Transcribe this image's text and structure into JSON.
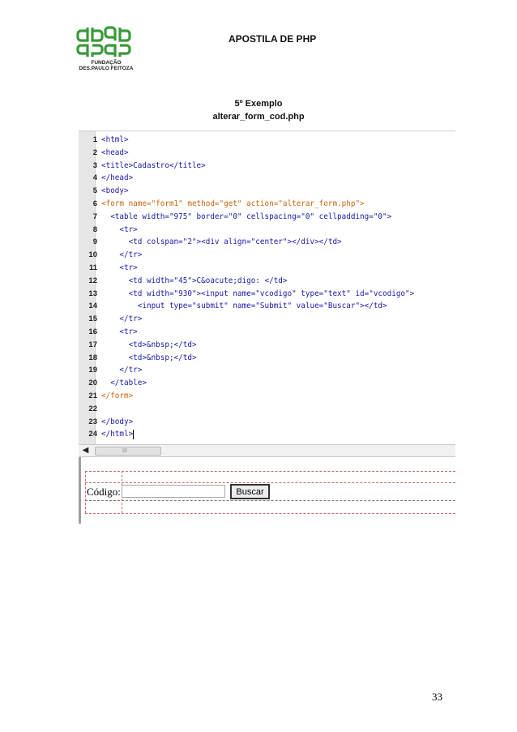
{
  "header": {
    "title": "APOSTILA DE PHP",
    "logo_lines": [
      "FUNDAÇÃO",
      "DES.PAULO FEITOZA"
    ],
    "logo_color": "#3a9a3a"
  },
  "example": {
    "title": "5º Exemplo",
    "filename": "alterar_form_cod.php"
  },
  "code": {
    "lines": [
      {
        "n": "1",
        "text": "<html>"
      },
      {
        "n": "2",
        "text": "<head>"
      },
      {
        "n": "3",
        "text": "<title>Cadastro</title>"
      },
      {
        "n": "4",
        "text": "</head>"
      },
      {
        "n": "5",
        "text": "<body>"
      },
      {
        "n": "6",
        "text": "<form name=\"form1\" method=\"get\" action=\"alterar_form.php\">"
      },
      {
        "n": "7",
        "text": "  <table width=\"975\" border=\"0\" cellspacing=\"0\" cellpadding=\"0\">"
      },
      {
        "n": "8",
        "text": "    <tr>"
      },
      {
        "n": "9",
        "text": "      <td colspan=\"2\"><div align=\"center\"></div></td>"
      },
      {
        "n": "10",
        "text": "    </tr>"
      },
      {
        "n": "11",
        "text": "    <tr>"
      },
      {
        "n": "12",
        "text": "      <td width=\"45\">C&oacute;digo: </td>"
      },
      {
        "n": "13",
        "text": "      <td width=\"930\"><input name=\"vcodigo\" type=\"text\" id=\"vcodigo\">"
      },
      {
        "n": "14",
        "text": "        <input type=\"submit\" name=\"Submit\" value=\"Buscar\"></td>"
      },
      {
        "n": "15",
        "text": "    </tr>"
      },
      {
        "n": "16",
        "text": "    <tr>"
      },
      {
        "n": "17",
        "text": "      <td>&nbsp;</td>"
      },
      {
        "n": "18",
        "text": "      <td>&nbsp;</td>"
      },
      {
        "n": "19",
        "text": "    </tr>"
      },
      {
        "n": "20",
        "text": "  </table>"
      },
      {
        "n": "21",
        "text": "</form>"
      },
      {
        "n": "22",
        "text": ""
      },
      {
        "n": "23",
        "text": "</body>"
      },
      {
        "n": "24",
        "text": "</html>"
      }
    ],
    "colors": {
      "tag": "#1a1aa6",
      "form_tag": "#c8660e"
    }
  },
  "scrollbar": {
    "left_arrow": "◀",
    "thumb_grip": "III"
  },
  "design_view": {
    "label": "Código:",
    "input_value": "",
    "button_label": "Buscar"
  },
  "page_number": "33"
}
